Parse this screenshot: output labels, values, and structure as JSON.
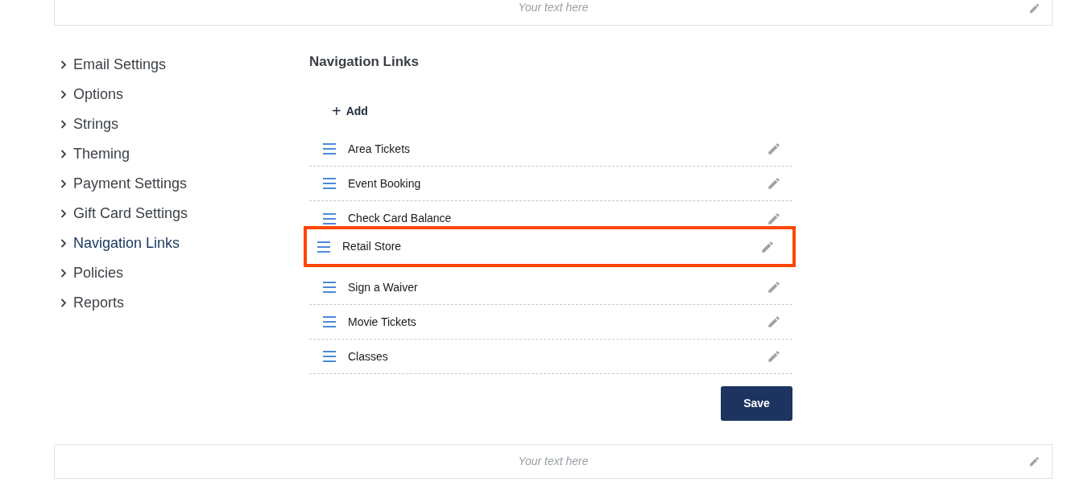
{
  "header_banner": {
    "placeholder": "Your text here"
  },
  "sidebar": {
    "items": [
      {
        "label": "Email Settings",
        "selected": false
      },
      {
        "label": "Options",
        "selected": false
      },
      {
        "label": "Strings",
        "selected": false
      },
      {
        "label": "Theming",
        "selected": false
      },
      {
        "label": "Payment Settings",
        "selected": false
      },
      {
        "label": "Gift Card Settings",
        "selected": false
      },
      {
        "label": "Navigation Links",
        "selected": true
      },
      {
        "label": "Policies",
        "selected": false
      },
      {
        "label": "Reports",
        "selected": false
      }
    ]
  },
  "main": {
    "title": "Navigation Links",
    "add_button": {
      "icon": "+",
      "label": "Add"
    },
    "links": [
      {
        "kind": "item",
        "label": "Area Tickets"
      },
      {
        "kind": "item",
        "label": "Event Booking"
      },
      {
        "kind": "item",
        "label": "Check Card Balance"
      },
      {
        "kind": "dragging",
        "label": "Retail Store"
      },
      {
        "kind": "item",
        "label": "Sign a Waiver"
      },
      {
        "kind": "item",
        "label": "Movie Tickets"
      },
      {
        "kind": "item",
        "label": "Classes"
      }
    ],
    "save_button": "Save"
  },
  "footer_banner": {
    "placeholder": "Your text here"
  }
}
